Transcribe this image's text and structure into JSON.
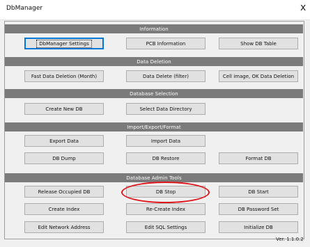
{
  "window": {
    "title": "DbManager",
    "close_glyph": "x"
  },
  "sections": {
    "information": "Information",
    "data_deletion": "Data Deletion",
    "database_selection": "Database Selection",
    "import_export_format": "Import/Export/Format",
    "database_admin_tools": "Database Admin Tools"
  },
  "buttons": {
    "dbmanager_settings": "DbManager Settings",
    "pcb_information": "PCB Information",
    "show_db_table": "Show DB Table",
    "fast_data_deletion": "Fast Data Deletion (Month)",
    "data_delete_filter": "Data Delete (filter)",
    "cell_image_ok_data_deletion": "Cell image, OK Data Deletion",
    "create_new_db": "Create New DB",
    "select_data_directory": "Select Data Directory",
    "export_data": "Export Data",
    "import_data": "Import Data",
    "db_dump": "DB Dump",
    "db_restore": "DB Restore",
    "format_db": "Format DB",
    "release_occupied_db": "Release Occupied DB",
    "db_stop": "DB Stop",
    "db_start": "DB Start",
    "create_index": "Create Index",
    "re_create_index": "Re-Create Index",
    "db_password_set": "DB Password Set",
    "edit_network_address": "Edit Network Address",
    "edit_sql_settings": "Edit SQL Settings",
    "initialize_db": "Initialize DB"
  },
  "annotation": {
    "highlight_color": "#e0141b",
    "highlight_shape": "ellipse"
  },
  "footer": {
    "version": "Ver. 1.1.0.2"
  }
}
